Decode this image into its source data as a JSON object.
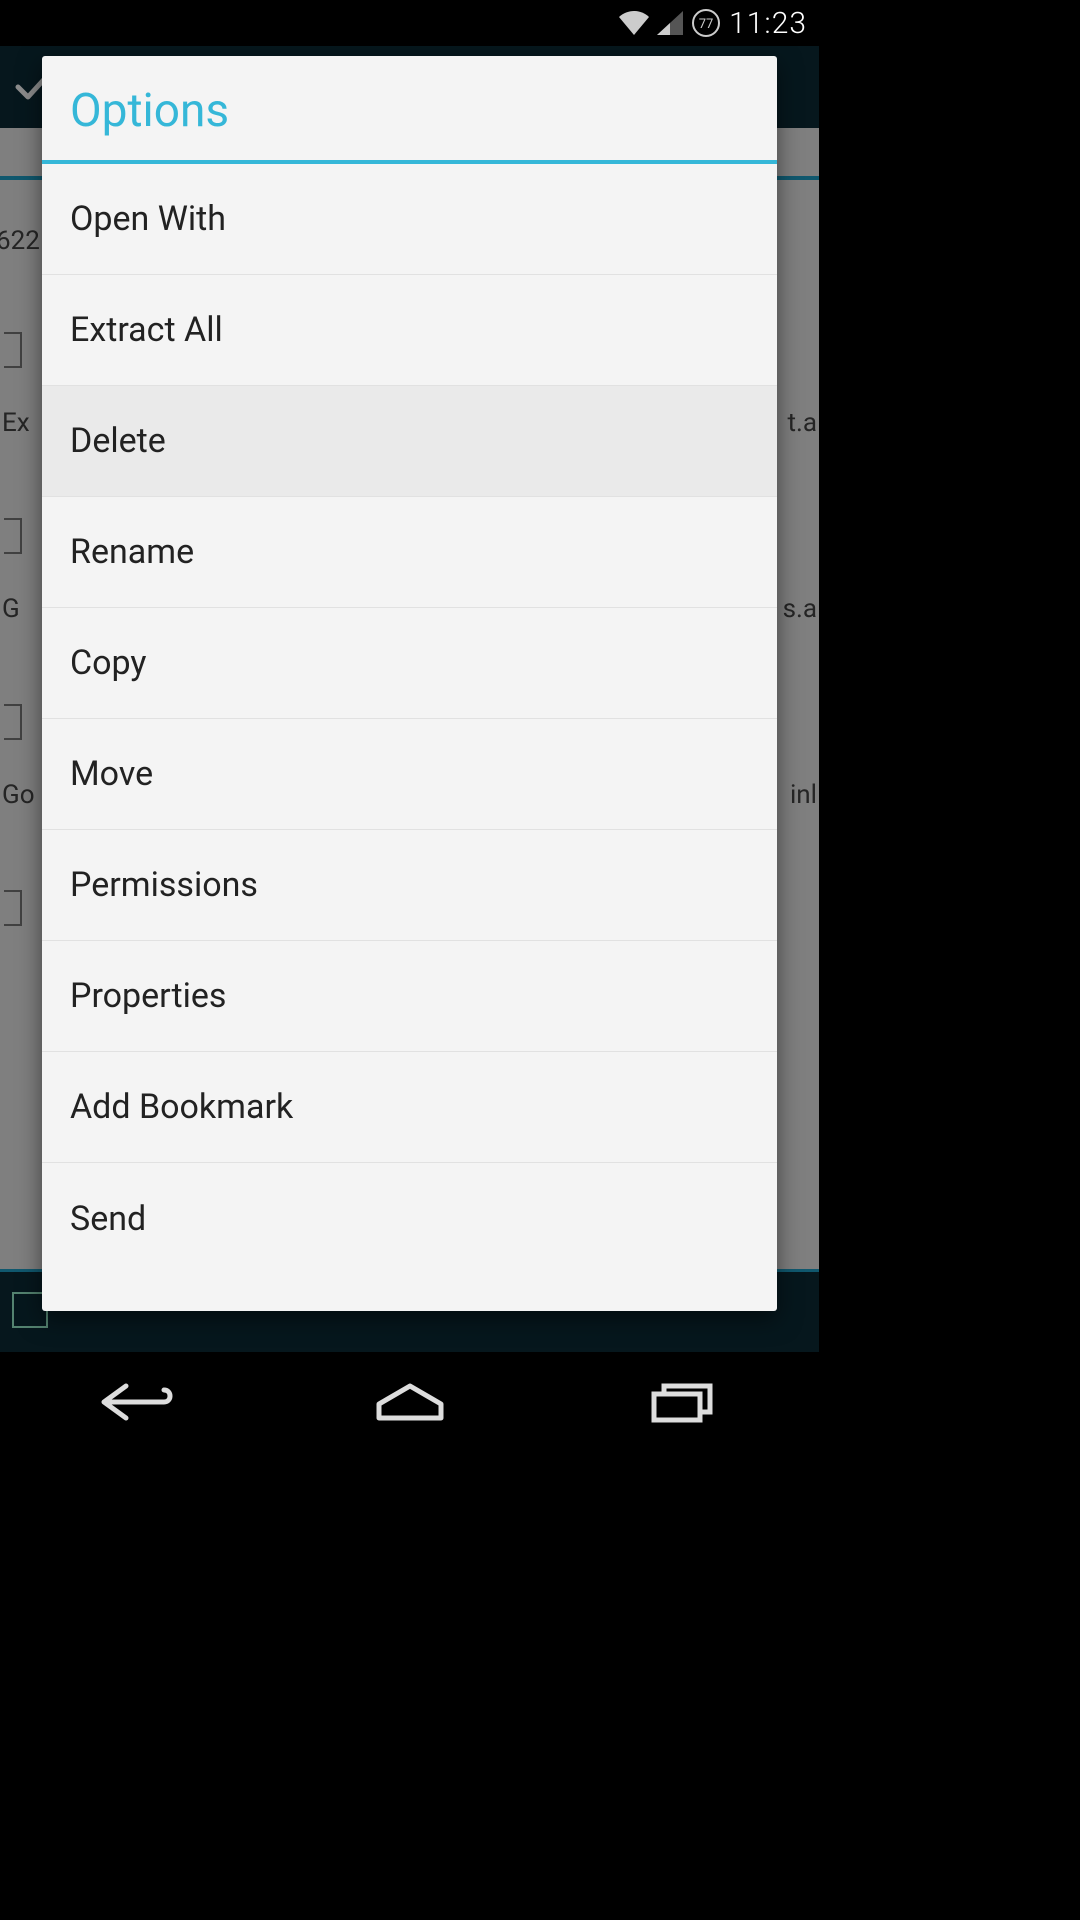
{
  "status": {
    "time": "11:23",
    "battery_percent": "77"
  },
  "background": {
    "partial_text_left_1": "622",
    "partial_text_left_2": "Ex",
    "partial_text_left_3": "G",
    "partial_text_left_4": "Go",
    "partial_text_right_1": "t.a",
    "partial_text_right_2": "s.a",
    "partial_text_right_3": "inl"
  },
  "dialog": {
    "title": "Options",
    "items": [
      {
        "label": "Open With",
        "pressed": false
      },
      {
        "label": "Extract All",
        "pressed": false
      },
      {
        "label": "Delete",
        "pressed": true
      },
      {
        "label": "Rename",
        "pressed": false
      },
      {
        "label": "Copy",
        "pressed": false
      },
      {
        "label": "Move",
        "pressed": false
      },
      {
        "label": "Permissions",
        "pressed": false
      },
      {
        "label": "Properties",
        "pressed": false
      },
      {
        "label": "Add Bookmark",
        "pressed": false
      },
      {
        "label": "Send",
        "pressed": false
      }
    ]
  }
}
